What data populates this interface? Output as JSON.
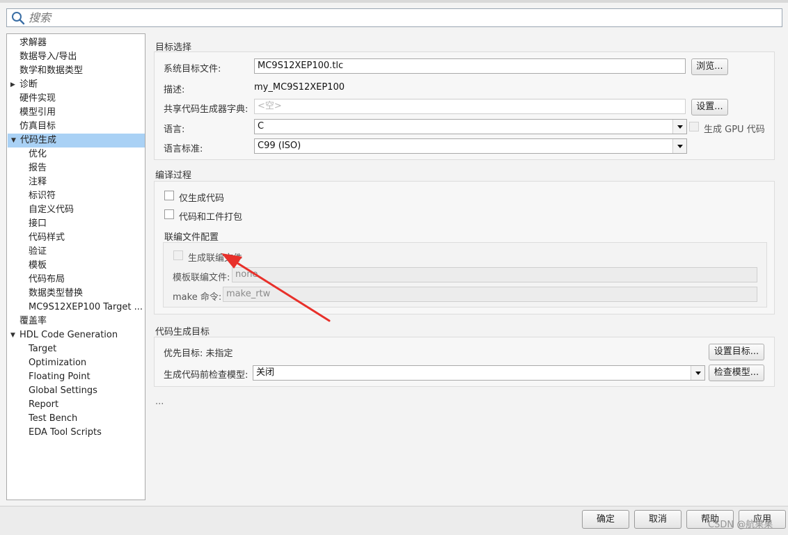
{
  "search": {
    "placeholder": "搜索",
    "icon": "search-icon"
  },
  "tree": [
    {
      "label": "求解器",
      "indent": 0
    },
    {
      "label": "数据导入/导出",
      "indent": 0
    },
    {
      "label": "数学和数据类型",
      "indent": 0
    },
    {
      "label": "诊断",
      "indent": 0,
      "arrow": "▶"
    },
    {
      "label": "硬件实现",
      "indent": 0
    },
    {
      "label": "模型引用",
      "indent": 0
    },
    {
      "label": "仿真目标",
      "indent": 0
    },
    {
      "label": "代码生成",
      "indent": 0,
      "arrow": "▼",
      "selected": true
    },
    {
      "label": "优化",
      "indent": 1
    },
    {
      "label": "报告",
      "indent": 1
    },
    {
      "label": "注释",
      "indent": 1
    },
    {
      "label": "标识符",
      "indent": 1
    },
    {
      "label": "自定义代码",
      "indent": 1
    },
    {
      "label": "接口",
      "indent": 1
    },
    {
      "label": "代码样式",
      "indent": 1
    },
    {
      "label": "验证",
      "indent": 1
    },
    {
      "label": "模板",
      "indent": 1
    },
    {
      "label": "代码布局",
      "indent": 1
    },
    {
      "label": "数据类型替换",
      "indent": 1
    },
    {
      "label": "MC9S12XEP100 Target ...",
      "indent": 1
    },
    {
      "label": "覆盖率",
      "indent": 0
    },
    {
      "label": "HDL Code Generation",
      "indent": 0,
      "arrow": "▼"
    },
    {
      "label": "Target",
      "indent": 1
    },
    {
      "label": "Optimization",
      "indent": 1
    },
    {
      "label": "Floating Point",
      "indent": 1
    },
    {
      "label": "Global Settings",
      "indent": 1
    },
    {
      "label": "Report",
      "indent": 1
    },
    {
      "label": "Test Bench",
      "indent": 1
    },
    {
      "label": "EDA Tool Scripts",
      "indent": 1
    }
  ],
  "target_section": {
    "title": "目标选择",
    "system_target_label": "系统目标文件:",
    "system_target_value": "MC9S12XEP100.tlc",
    "browse_button": "浏览...",
    "description_label": "描述:",
    "description_value": "my_MC9S12XEP100",
    "dictionary_label": "共享代码生成器字典:",
    "dictionary_placeholder": "<空>",
    "settings_button": "设置...",
    "language_label": "语言:",
    "language_value": "C",
    "gpu_label": "生成 GPU 代码",
    "standard_label": "语言标准:",
    "standard_value": "C99 (ISO)"
  },
  "build_section": {
    "title": "编译过程",
    "generate_only": "仅生成代码",
    "package_artifacts": "代码和工件打包",
    "makefile_config_title": "联编文件配置",
    "generate_makefile": "生成联编文件",
    "template_makefile_label": "模板联编文件:",
    "template_makefile_value": "none",
    "make_command_label": "make 命令:",
    "make_command_value": "make_rtw"
  },
  "objectives_section": {
    "title": "代码生成目标",
    "priority_label": "优先目标: 未指定",
    "set_objectives_button": "设置目标...",
    "check_model_label": "生成代码前检查模型:",
    "check_model_value": "关闭",
    "check_model_button": "检查模型..."
  },
  "ellipsis": "...",
  "footer": {
    "ok": "确定",
    "cancel": "取消",
    "help": "帮助",
    "apply": "应用"
  },
  "watermark": "CSDN @航果果",
  "colors": {
    "selection": "#a9d1f5",
    "annotation_arrow": "#e8302a"
  }
}
